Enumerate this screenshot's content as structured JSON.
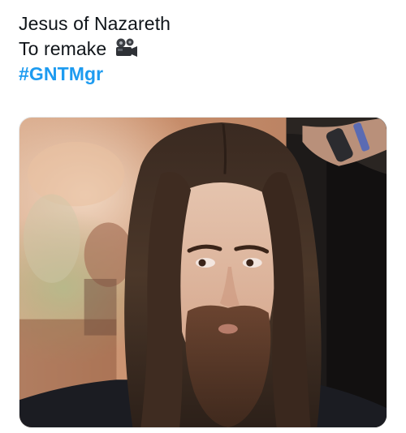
{
  "tweet": {
    "line1": "Jesus of Nazareth",
    "line2": "To remake",
    "emoji_icon": "movie-camera-icon",
    "hashtag": "#GNTMgr",
    "hashtag_color": "#1d9bf0",
    "text_color": "#0f1419"
  },
  "media": {
    "kind": "photo",
    "subject": "man-with-long-hair-and-beard"
  }
}
